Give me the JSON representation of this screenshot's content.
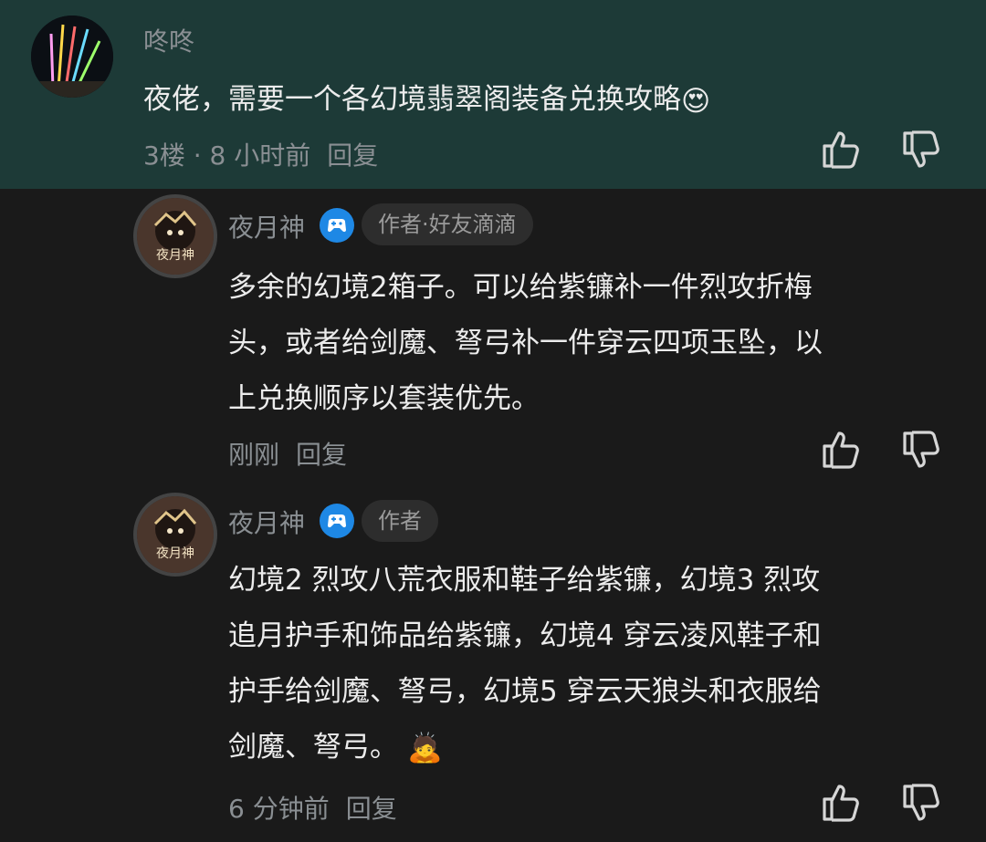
{
  "top_comment": {
    "user": "咚咚",
    "text": "夜佬，需要一个各幻境翡翠阁装备兑换攻略",
    "emoji": "😍",
    "floor_time": "3楼 · 8 小时前",
    "reply_label": "回复"
  },
  "reply1": {
    "user": "夜月神",
    "tag": "作者·好友滴滴",
    "lines": [
      "多余的幻境2箱子。可以给紫镰补一件烈攻折梅",
      "头，或者给剑魔、弩弓补一件穿云四项玉坠，以",
      "上兑换顺序以套装优先。"
    ],
    "time": "刚刚",
    "reply_label": "回复"
  },
  "reply2": {
    "user": "夜月神",
    "tag": "作者",
    "lines": [
      "幻境2 烈攻八荒衣服和鞋子给紫镰，幻境3 烈攻",
      "追月护手和饰品给紫镰，幻境4 穿云凌风鞋子和",
      "护手给剑魔、弩弓，幻境5 穿云天狼头和衣服给",
      "剑魔、弩弓。"
    ],
    "emoji": "🙇",
    "time": "6 分钟前",
    "reply_label": "回复"
  },
  "avatar_text": "夜月神",
  "colors": {
    "top_bg": "#1d3a37",
    "body_bg": "#1a1a1a",
    "badge_blue": "#1e88e5"
  }
}
